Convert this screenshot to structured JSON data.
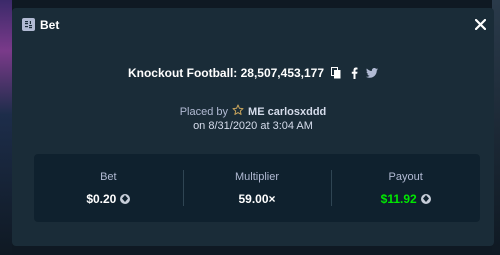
{
  "header": {
    "title": "Bet",
    "icon": "bet-icon",
    "close_icon": "close-icon"
  },
  "game": {
    "title": "Knockout Football: 28,507,453,177",
    "icons": [
      "copy-icon",
      "facebook-icon",
      "twitter-icon"
    ]
  },
  "placed": {
    "prefix": "Placed by",
    "user_icon": "star-icon",
    "username": "ME carlosxddd",
    "date": "on 8/31/2020 at 3:04 AM"
  },
  "stats": {
    "bet": {
      "label": "Bet",
      "value": "$0.20",
      "icon": "currency-icon"
    },
    "multiplier": {
      "label": "Multiplier",
      "value": "59.00×"
    },
    "payout": {
      "label": "Payout",
      "value": "$11.92",
      "icon": "currency-icon"
    }
  },
  "colors": {
    "background": "#0f1923",
    "modal": "#1a2c38",
    "panel": "#0f212e",
    "text_muted": "#b1bad3",
    "payout_green": "#00e701"
  }
}
